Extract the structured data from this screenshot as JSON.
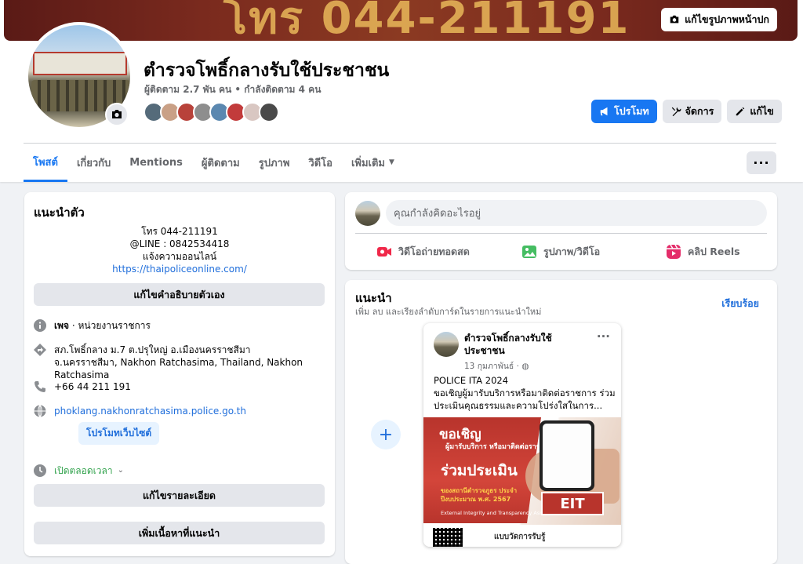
{
  "cover": {
    "text": "โทร 044-211191",
    "edit_cover_label": "แก้ไขรูปภาพหน้าปก"
  },
  "page": {
    "name": "ตำรวจโพธิ์กลางรับใช้ประชาชน",
    "stats": "ผู้ติดตาม 2.7 พัน คน • กำลังติดตาม 4 คน"
  },
  "actions": {
    "promote": "โปรโมท",
    "manage": "จัดการ",
    "edit": "แก้ไข"
  },
  "tabs": [
    {
      "label": "โพสต์"
    },
    {
      "label": "เกี่ยวกับ"
    },
    {
      "label": "Mentions"
    },
    {
      "label": "ผู้ติดตาม"
    },
    {
      "label": "รูปภาพ"
    },
    {
      "label": "วิดีโอ"
    },
    {
      "label": "เพิ่มเติม"
    }
  ],
  "intro": {
    "title": "แนะนำตัว",
    "bio_lines": [
      "โทร 044-211191",
      "@LINE : 0842534418",
      "แจ้งความออนไลน์"
    ],
    "bio_link": "https://thaipoliceonline.com/",
    "edit_bio": "แก้ไขคำอธิบายตัวเอง",
    "page_type_bold": "เพจ",
    "page_type_rest": " · หน่วยงานราชการ",
    "address": "สภ.โพธิ์กลาง ม.7 ต.ปรุใหญ่ อ.เมืองนครราชสีมา จ.นครราชสีมา, Nakhon Ratchasima, Thailand, Nakhon Ratchasima",
    "phone": "+66 44 211 191",
    "website": "phoklang.nakhonratchasima.police.go.th",
    "promote_website": "โปรโมทเว็บไซต์",
    "hours": "เปิดตลอดเวลา",
    "edit_details": "แก้ไขรายละเอียด",
    "add_featured": "เพิ่มเนื้อหาที่แนะนำ"
  },
  "composer": {
    "placeholder": "คุณกำลังคิดอะไรอยู่",
    "live": "วิดีโอถ่ายทอดสด",
    "photo": "รูปภาพ/วิดีโอ",
    "reels": "คลิป Reels"
  },
  "featured": {
    "title": "แนะนำ",
    "subtitle": "เพิ่ม ลบ และเรียงลำดับการ์ดในรายการแนะนำใหม่",
    "done": "เรียบร้อย",
    "post": {
      "author": "ตำรวจโพธิ์กลางรับใช้ประชาชน",
      "date": "13 กุมภาพันธ์ ·",
      "line1": "POLICE ITA 2024",
      "line2": "ขอเชิญผู้มารับบริการหรือมาติดต่อราชการ ร่วมประเมินคุณธรรมและความโปร่งใสในการ...",
      "img_invite": "ขอเชิญ",
      "img_sub": "ผู้มารับบริการ หรือมาติดต่อราชการ",
      "img_eval": "ร่วมประเมิน",
      "img_org": "ของสถานีตำรวจภูธร ประจำปีงบประมาณ พ.ศ. 2567",
      "img_ext": "External Integrity and Transparency Assessment",
      "img_eit": "EIT",
      "img_scan": "แบบวัดการรับรู้"
    }
  },
  "colors": {
    "accent": "#1877f2",
    "link": "#216fdb",
    "background": "#f0f2f5"
  }
}
